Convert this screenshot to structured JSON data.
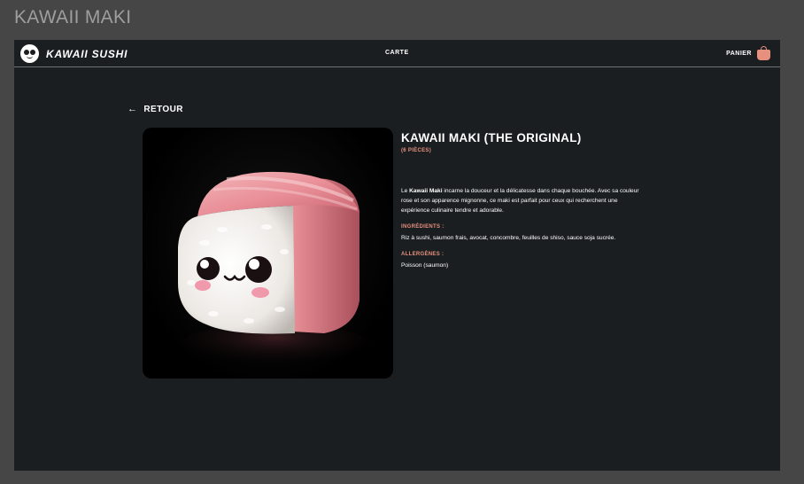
{
  "page": {
    "heading": "KAWAII MAKI"
  },
  "navbar": {
    "brand": "KAWAII SUSHI",
    "menu_label": "CARTE",
    "cart_label": "PANIER"
  },
  "back_label": "RETOUR",
  "product": {
    "name": "KAWAII MAKI (THE ORIGINAL)",
    "pieces": "(6 PIÈCES)",
    "description_name": "Kawaii Maki",
    "description_rest": " incarne la douceur et la délicatesse dans chaque bouchée. Avec sa couleur rose et son apparence mignonne, ce maki est parfait pour ceux qui recherchent une expérience culinaire tendre et adorable.",
    "ingredients_label": "INGRÉDIENTS :",
    "ingredients": "Riz à sushi, saumon frais, avocat, concombre, feuilles de shiso, sauce soja sucrée.",
    "allergens_label": "ALLERGÈNES :",
    "allergens": "Poisson (saumon)",
    "description_prefix": "Le "
  },
  "colors": {
    "accent": "#e8907e",
    "frame_bg": "#1a1e20",
    "outer_bg": "#464646"
  }
}
